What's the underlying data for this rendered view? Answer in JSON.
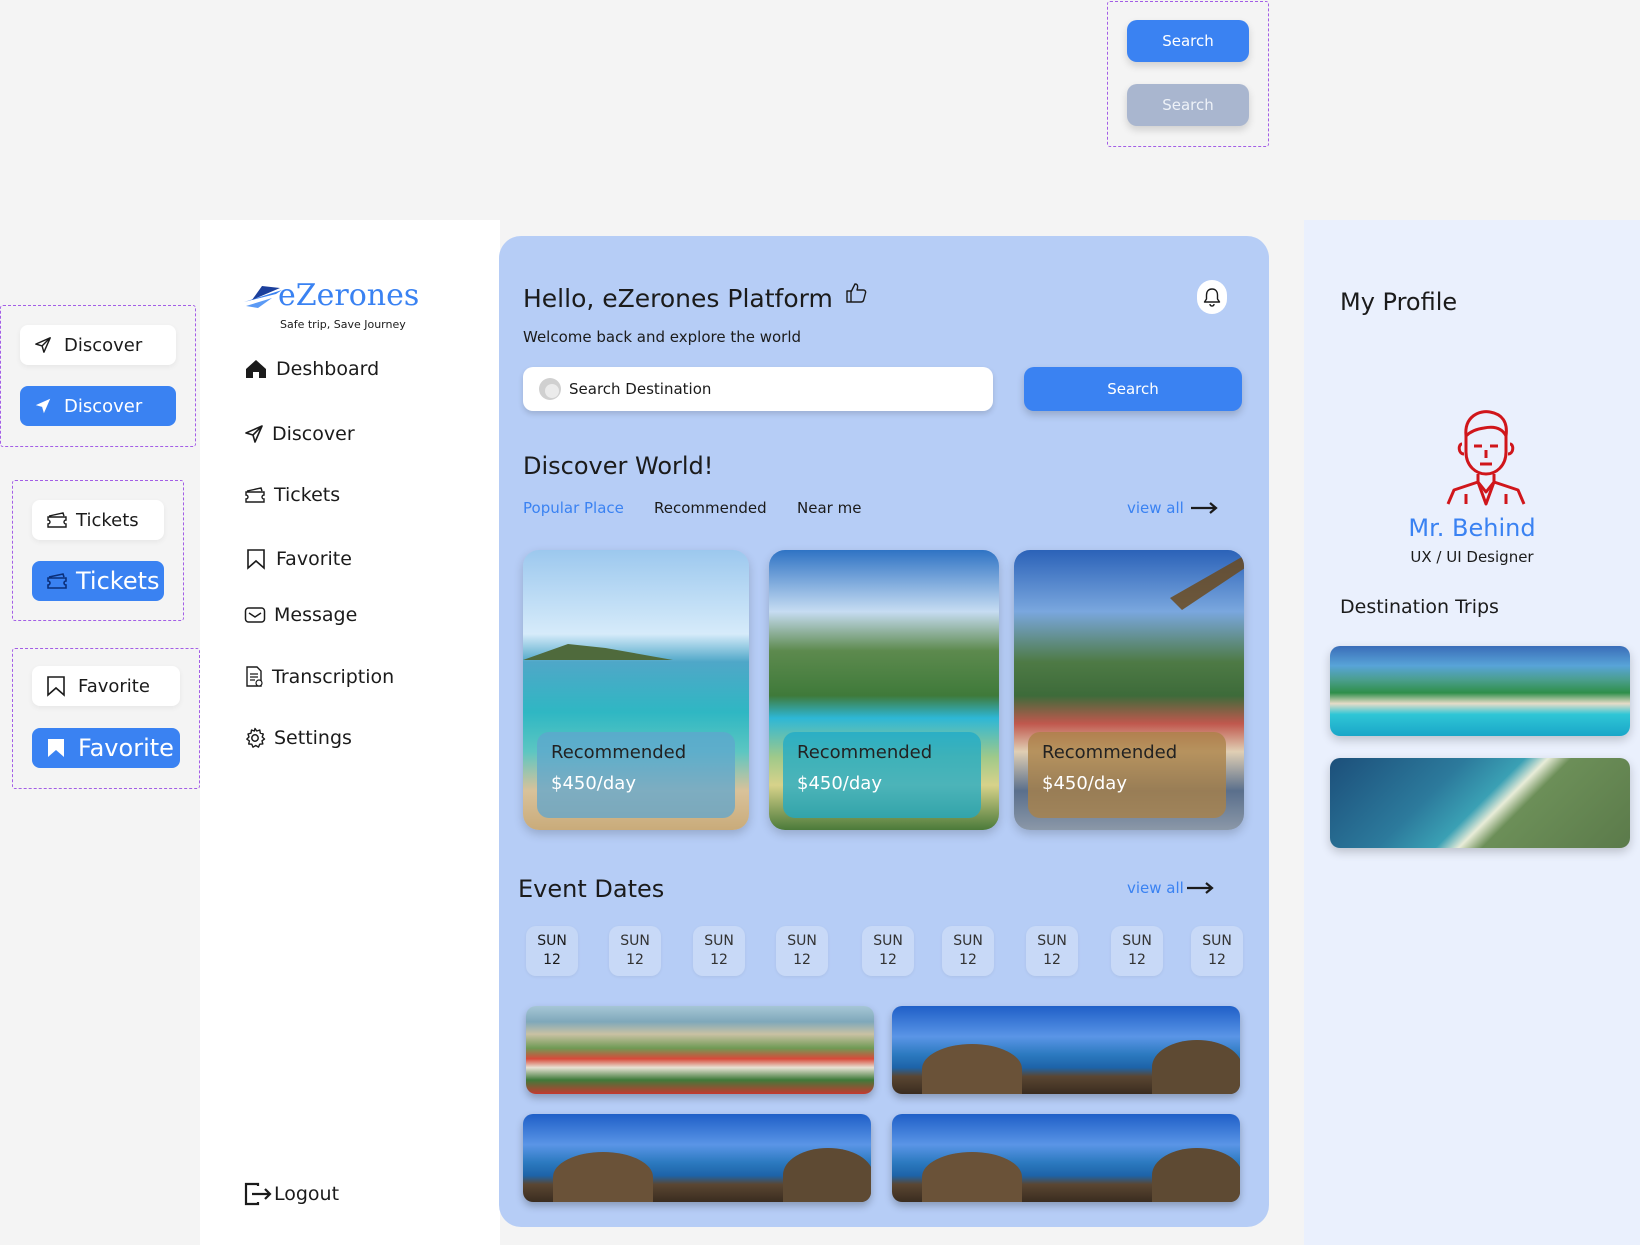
{
  "spec_search": {
    "active_label": "Search",
    "disabled_label": "Search"
  },
  "spec_nav": {
    "discover_white": "Discover",
    "discover_blue": "Discover",
    "tickets_white": "Tickets",
    "tickets_blue": "Tickets",
    "favorite_white": "Favorite",
    "favorite_blue": "Favorite"
  },
  "brand": {
    "name": "eZerones",
    "tagline": "Safe trip, Save Journey"
  },
  "sidebar": {
    "items": [
      {
        "label": "Deshboard",
        "icon": "home-icon"
      },
      {
        "label": "Discover",
        "icon": "send-icon"
      },
      {
        "label": "Tickets",
        "icon": "ticket-icon"
      },
      {
        "label": "Favorite",
        "icon": "bookmark-icon"
      },
      {
        "label": "Message",
        "icon": "mail-icon"
      },
      {
        "label": "Transcription",
        "icon": "document-icon"
      },
      {
        "label": "Settings",
        "icon": "gear-icon"
      }
    ],
    "logout": "Logout"
  },
  "header": {
    "greeting": "Hello, eZerones Platform",
    "subtitle": "Welcome back and explore the world"
  },
  "search": {
    "placeholder": "Search Destination",
    "button": "Search"
  },
  "discover": {
    "title": "Discover World!",
    "tabs": [
      "Popular Place",
      "Recommended",
      "Near me"
    ],
    "view_all": "view all",
    "cards": [
      {
        "label": "Recommended",
        "price": "$450/day"
      },
      {
        "label": "Recommended",
        "price": "$450/day"
      },
      {
        "label": "Recommended",
        "price": "$450/day"
      }
    ]
  },
  "events": {
    "title": "Event Dates",
    "view_all": "view all",
    "dates": [
      {
        "day": "SUN",
        "num": "12"
      },
      {
        "day": "SUN",
        "num": "12"
      },
      {
        "day": "SUN",
        "num": "12"
      },
      {
        "day": "SUN",
        "num": "12"
      },
      {
        "day": "SUN",
        "num": "12"
      },
      {
        "day": "SUN",
        "num": "12"
      },
      {
        "day": "SUN",
        "num": "12"
      },
      {
        "day": "SUN",
        "num": "12"
      },
      {
        "day": "SUN",
        "num": "12"
      }
    ]
  },
  "profile": {
    "title": "My Profile",
    "name": "Mr. Behind",
    "role": "UX / UI Designer",
    "trips_title": "Destination Trips"
  },
  "colors": {
    "accent": "#3a82f2",
    "panel": "#b6cdf6",
    "disabled": "#a9b6cf",
    "avatar": "#d0161b"
  }
}
